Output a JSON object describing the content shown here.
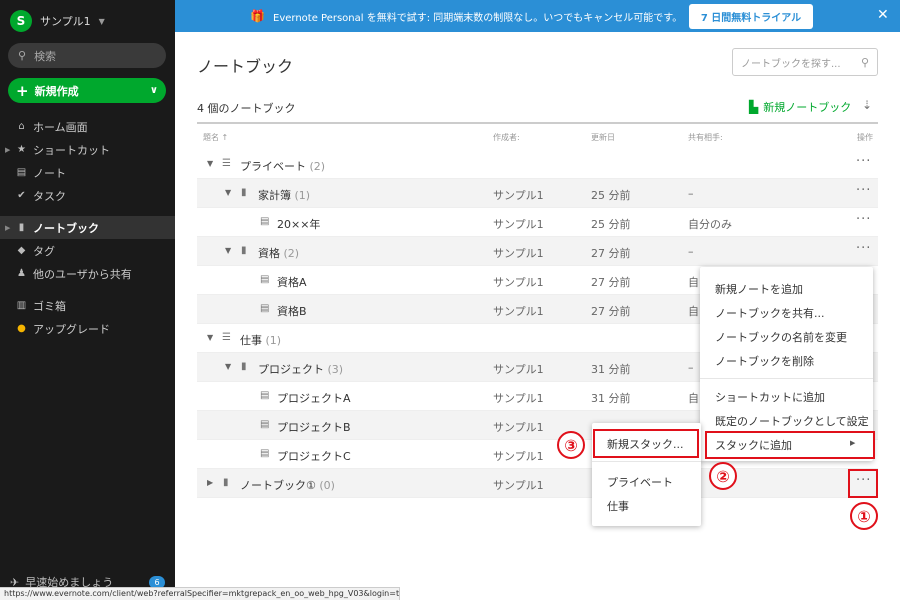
{
  "sidebar": {
    "account_name": "サンプル1",
    "logo_letter": "S",
    "search_placeholder": "検索",
    "new_button": "新規作成",
    "nav": [
      {
        "label": "ホーム画面",
        "icon": "home-icon",
        "glyph": "⌂"
      },
      {
        "label": "ショートカット",
        "icon": "star-icon",
        "glyph": "★"
      },
      {
        "label": "ノート",
        "icon": "note-icon",
        "glyph": "▤"
      },
      {
        "label": "タスク",
        "icon": "check-circle-icon",
        "glyph": "✔"
      },
      {
        "label": "ノートブック",
        "icon": "notebook-icon",
        "glyph": "▮"
      },
      {
        "label": "タグ",
        "icon": "tag-icon",
        "glyph": "◆"
      },
      {
        "label": "他のユーザから共有",
        "icon": "people-icon",
        "glyph": "👥"
      },
      {
        "label": "ゴミ箱",
        "icon": "trash-icon",
        "glyph": "🗑"
      },
      {
        "label": "アップグレード",
        "icon": "upgrade-icon",
        "glyph": "●"
      }
    ],
    "quickstart_label": "早速始めましょう",
    "quickstart_badge": "6"
  },
  "status_url": "https://www.evernote.com/client/web?referralSpecifier=mktgrepack_en_oo_web_hpg_V03&login=true",
  "banner": {
    "text": "Evernote Personal を無料で試す: 同期端末数の制限なし。いつでもキャンセル可能です。",
    "button": "7 日間無料トライアル",
    "color": "#2b8fd6"
  },
  "main": {
    "title": "ノートブック",
    "search_placeholder": "ノートブックを探す...",
    "count_label": "4 個のノートブック",
    "new_notebook": "新規ノートブック",
    "columns": {
      "name": "題名 ↑",
      "creator": "作成者:",
      "updated": "更新日",
      "shared": "共有相手:",
      "actions": "操作"
    },
    "rows": [
      {
        "name": "プライベート",
        "num": "(2)",
        "creator": "",
        "updated": "",
        "shared": ""
      },
      {
        "name": "家計簿",
        "num": "(1)",
        "creator": "サンプル1",
        "updated": "25 分前",
        "shared": "–"
      },
      {
        "name": "20××年",
        "num": "",
        "creator": "サンプル1",
        "updated": "25 分前",
        "shared": "自分のみ"
      },
      {
        "name": "資格",
        "num": "(2)",
        "creator": "サンプル1",
        "updated": "27 分前",
        "shared": "–"
      },
      {
        "name": "資格A",
        "num": "",
        "creator": "サンプル1",
        "updated": "27 分前",
        "shared": "自"
      },
      {
        "name": "資格B",
        "num": "",
        "creator": "サンプル1",
        "updated": "27 分前",
        "shared": "自"
      },
      {
        "name": "仕事",
        "num": "(1)",
        "creator": "",
        "updated": "",
        "shared": ""
      },
      {
        "name": "プロジェクト",
        "num": "(3)",
        "creator": "サンプル1",
        "updated": "31 分前",
        "shared": "–"
      },
      {
        "name": "プロジェクトA",
        "num": "",
        "creator": "サンプル1",
        "updated": "31 分前",
        "shared": "自"
      },
      {
        "name": "プロジェクトB",
        "num": "",
        "creator": "サンプル1",
        "updated": "",
        "shared": ""
      },
      {
        "name": "プロジェクトC",
        "num": "",
        "creator": "サンプル1",
        "updated": "",
        "shared": ""
      },
      {
        "name": "ノートブック①",
        "num": "(0)",
        "creator": "サンプル1",
        "updated": "",
        "shared": ""
      }
    ]
  },
  "context_menu": {
    "items": [
      "新規ノートを追加",
      "ノートブックを共有...",
      "ノートブックの名前を変更",
      "ノートブックを削除",
      "ショートカットに追加",
      "既定のノートブックとして設定",
      "スタックに追加"
    ]
  },
  "submenu": {
    "items": [
      "新規スタック...",
      "プライベート",
      "仕事"
    ]
  },
  "markers": [
    "①",
    "②",
    "③"
  ]
}
